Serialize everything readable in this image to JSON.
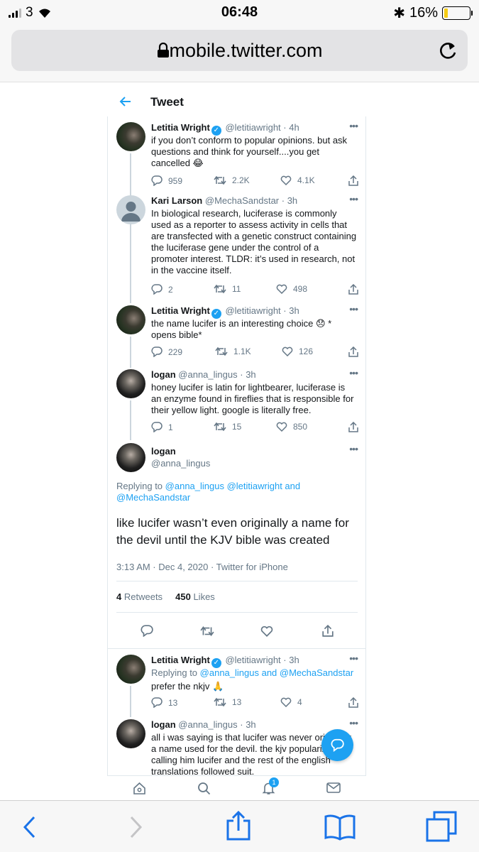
{
  "status": {
    "carrier": "3",
    "time": "06:48",
    "battery": "16%",
    "battery_level": 0.16
  },
  "browser": {
    "url": "mobile.twitter.com"
  },
  "header": {
    "title": "Tweet"
  },
  "tweets": [
    {
      "name": "Letitia Wright",
      "verified": true,
      "handle": "@letitiawright",
      "time": "4h",
      "text": "if you don’t conform to popular opinions. but ask questions and think for yourself....you get cancelled 😂",
      "replies": "959",
      "retweets": "2.2K",
      "likes": "4.1K"
    },
    {
      "name": "Kari Larson",
      "verified": false,
      "handle": "@MechaSandstar",
      "time": "3h",
      "text": "In biological research, luciferase is commonly used as a reporter to assess activity in cells that are transfected with a genetic construct containing the luciferase gene under the control of a promoter interest.  TLDR: it’s used in research, not in the vaccine itself.",
      "replies": "2",
      "retweets": "11",
      "likes": "498"
    },
    {
      "name": "Letitia Wright",
      "verified": true,
      "handle": "@letitiawright",
      "time": "3h",
      "text": "the name lucifer is an interesting choice 😞 * opens bible*",
      "replies": "229",
      "retweets": "1.1K",
      "likes": "126"
    },
    {
      "name": "logan",
      "verified": false,
      "handle": "@anna_lingus",
      "time": "3h",
      "text": "honey lucifer is latin for lightbearer, luciferase is an enzyme found in fireflies that is responsible for their yellow light. google is literally free.",
      "replies": "1",
      "retweets": "15",
      "likes": "850"
    }
  ],
  "main_tweet": {
    "name": "logan",
    "handle": "@anna_lingus",
    "replying_label": "Replying to",
    "replying_to": "@anna_lingus @letitiawright and @MechaSandstar",
    "text": "like lucifer wasn’t even originally a name for the devil until the KJV bible was created",
    "timestamp": "3:13 AM · Dec 4, 2020 · Twitter for iPhone",
    "retweets_count": "4",
    "retweets_label": "Retweets",
    "likes_count": "450",
    "likes_label": "Likes"
  },
  "replies": [
    {
      "name": "Letitia Wright",
      "verified": true,
      "handle": "@letitiawright",
      "time": "3h",
      "replying_label": "Replying to",
      "replying_to": "@anna_lingus and @MechaSandstar",
      "text": "prefer the nkjv 🙏",
      "replies": "13",
      "retweets": "13",
      "likes": "4"
    },
    {
      "name": "logan",
      "verified": false,
      "handle": "@anna_lingus",
      "time": "3h",
      "text": "all i was saying is that lucifer was never originally a name used for the devil. the kjv popularized calling him lucifer and the rest of the english translations followed suit."
    }
  ],
  "nav": {
    "notification_count": "1"
  },
  "colors": {
    "accent": "#1da1f2",
    "text": "#14171a",
    "muted": "#657786",
    "border": "#e1e8ed"
  }
}
